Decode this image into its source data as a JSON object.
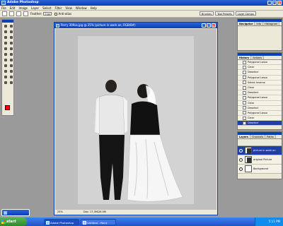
{
  "app": {
    "title": "Adobe Photoshop"
  },
  "menu": [
    "File",
    "Edit",
    "Image",
    "Layer",
    "Select",
    "Filter",
    "View",
    "Window",
    "Help"
  ],
  "options_bar": {
    "feather_label": "Feather:",
    "feather_value": "0 px",
    "antialias_label": "Anti-alias"
  },
  "palette_wells": [
    "Brushes",
    "Tool Presets",
    "Layer Comps"
  ],
  "document": {
    "title": "Perry 309sa.jpg @ 25% (picture in work on, RGB/8#)",
    "zoom": "25%",
    "doc_size": "Doc: 17.0M/26.0M"
  },
  "navigator": {
    "tabs": [
      "Navigator",
      "Info",
      "Histogram"
    ]
  },
  "history": {
    "tabs": [
      "History",
      "Actions"
    ],
    "items": [
      "Polygonal Lasso",
      "Clear",
      "Deselect",
      "Polygonal Lasso",
      "Select Inverse",
      "Clear",
      "Deselect",
      "Polygonal Lasso",
      "Clear",
      "Deselect",
      "Polygonal Lasso",
      "Clear",
      "Deselect",
      "Polygonal Lasso",
      "Clear",
      "Deselect"
    ]
  },
  "layers": {
    "tabs": [
      "Layers",
      "Channels",
      "Paths"
    ],
    "items": [
      {
        "name": "picture in work on",
        "selected": true
      },
      {
        "name": "original Picture",
        "selected": false
      },
      {
        "name": "Background",
        "selected": false
      }
    ]
  },
  "taskbar": {
    "start_label": "start",
    "buttons": [
      "Adobe Photoshop",
      "Untitled - Paint"
    ],
    "clock": "5:11 PM"
  },
  "colors": {
    "foreground": "#ff0000",
    "background": "#ffffff",
    "title_blue": "#0a3fb8"
  }
}
